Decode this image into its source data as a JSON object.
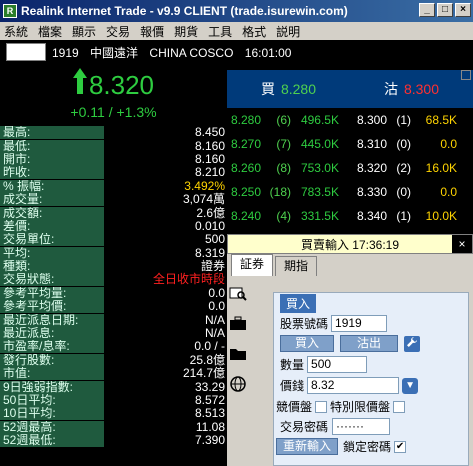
{
  "window": {
    "title": "Realink Internet Trade - v9.9 CLIENT (trade.isurewin.com)",
    "icon_letter": "R",
    "controls": [
      "_",
      "□",
      "×"
    ]
  },
  "menu": [
    "系統",
    "檔案",
    "顯示",
    "交易",
    "報價",
    "期貨",
    "工具",
    "格式",
    "説明"
  ],
  "quote_header": {
    "code": "1919",
    "name_cn": "中國遠洋",
    "name_en": "CHINA COSCO",
    "time": "16:01:00"
  },
  "price": {
    "last": "8.320",
    "arrow": "up-arrow",
    "change": "+0.11 / +1.3%"
  },
  "stats": [
    {
      "label": "最高:",
      "value": "8.450",
      "style": ""
    },
    {
      "label": "最低:",
      "value": "8.160",
      "style": ""
    },
    {
      "label": "開市:",
      "value": "8.160",
      "style": ""
    },
    {
      "label": "昨收:",
      "value": "8.210",
      "style": ""
    },
    {
      "label": "% 振幅:",
      "value": "3.492%",
      "style": "y"
    },
    {
      "label": "成交量:",
      "value": "3,074萬",
      "style": ""
    },
    {
      "label": "成交額:",
      "value": "2.6億",
      "style": ""
    },
    {
      "label": "差價:",
      "value": "0.010",
      "style": ""
    },
    {
      "label": "交易單位:",
      "value": "500",
      "style": ""
    },
    {
      "label": "平均:",
      "value": "8.319",
      "style": ""
    },
    {
      "label": "種類:",
      "value": "證券",
      "style": ""
    },
    {
      "label": "交易狀態:",
      "value": "全日收市時段",
      "style": "r"
    },
    {
      "label": "參考平均量:",
      "value": "0.0",
      "style": ""
    },
    {
      "label": "參考平均價:",
      "value": "0.0",
      "style": ""
    },
    {
      "label": "最近派息日期:",
      "value": "N/A",
      "style": ""
    },
    {
      "label": "最近派息:",
      "value": "N/A",
      "style": ""
    },
    {
      "label": "市盈率/息率:",
      "value": "0.0 / -",
      "style": ""
    },
    {
      "label": "發行股數:",
      "value": "25.8億",
      "style": ""
    },
    {
      "label": "市值:",
      "value": "214.7億",
      "style": ""
    },
    {
      "label": "9日強弱指數:",
      "value": "33.29",
      "style": ""
    },
    {
      "label": "50日平均:",
      "value": "8.572",
      "style": ""
    },
    {
      "label": "10日平均:",
      "value": "8.513",
      "style": ""
    },
    {
      "label": "52週最高:",
      "value": "11.08",
      "style": ""
    },
    {
      "label": "52週最低:",
      "value": "7.390",
      "style": ""
    }
  ],
  "depth": {
    "bid_label": "買",
    "bid_price": "8.280",
    "ask_label": "沽",
    "ask_price": "8.300",
    "rows": [
      {
        "bp": "8.280",
        "bc": "(6)",
        "bv": "496.5K",
        "ap": "8.300",
        "ac": "(1)",
        "av": "68.5K"
      },
      {
        "bp": "8.270",
        "bc": "(7)",
        "bv": "445.0K",
        "ap": "8.310",
        "ac": "(0)",
        "av": "0.0"
      },
      {
        "bp": "8.260",
        "bc": "(8)",
        "bv": "753.0K",
        "ap": "8.320",
        "ac": "(2)",
        "av": "16.0K"
      },
      {
        "bp": "8.250",
        "bc": "(18)",
        "bv": "783.5K",
        "ap": "8.330",
        "ac": "(0)",
        "av": "0.0"
      },
      {
        "bp": "8.240",
        "bc": "(4)",
        "bv": "331.5K",
        "ap": "8.340",
        "ac": "(1)",
        "av": "10.0K"
      }
    ]
  },
  "order": {
    "header": "買賣輸入 17:36:19",
    "close": "×",
    "tabs": [
      "証券",
      "期指"
    ],
    "side_tag": "買入",
    "code_label": "股票號碼",
    "code_value": "1919",
    "buy_btn": "買入",
    "sell_btn": "沽出",
    "qty_label": "數量",
    "qty_value": "500",
    "price_label": "價錢",
    "price_value": "8.32",
    "auction_label": "競價盤",
    "special_label": "特別限價盤",
    "pwd_label": "交易密碼",
    "pwd_value": "·······",
    "reset_btn": "重新輸入",
    "lock_label": "鎖定密碼",
    "lock_checked": "✔"
  }
}
